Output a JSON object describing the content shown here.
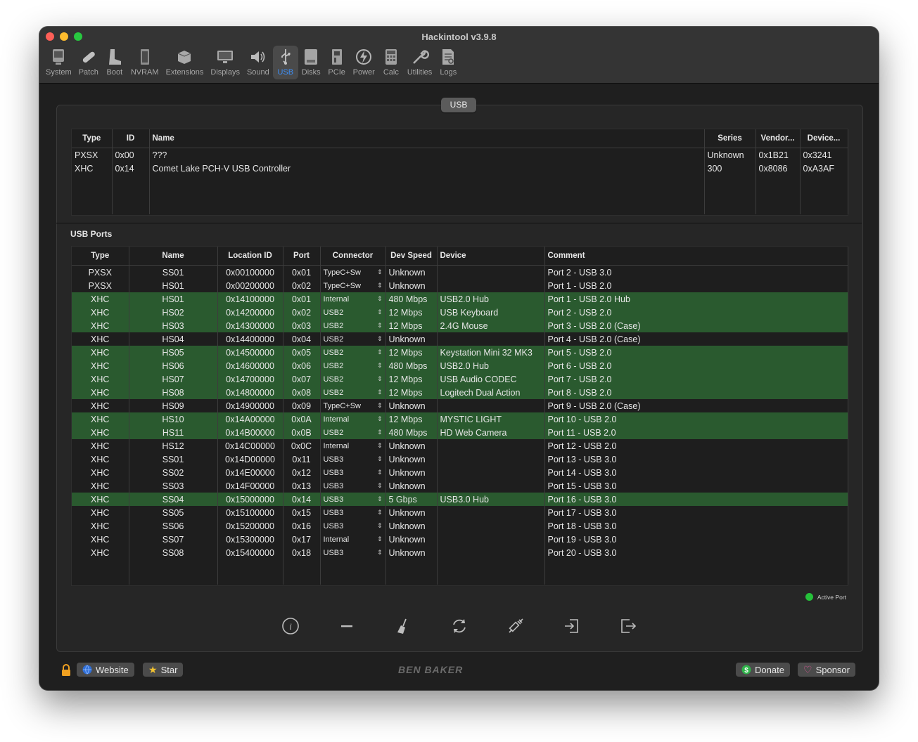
{
  "window": {
    "title": "Hackintool v3.9.8"
  },
  "toolbar": [
    {
      "label": "System",
      "icon": "system-icon"
    },
    {
      "label": "Patch",
      "icon": "patch-icon"
    },
    {
      "label": "Boot",
      "icon": "boot-icon"
    },
    {
      "label": "NVRAM",
      "icon": "nvram-icon"
    },
    {
      "label": "Extensions",
      "icon": "extensions-icon"
    },
    {
      "label": "Displays",
      "icon": "displays-icon"
    },
    {
      "label": "Sound",
      "icon": "sound-icon"
    },
    {
      "label": "USB",
      "icon": "usb-icon",
      "active": true
    },
    {
      "label": "Disks",
      "icon": "disks-icon"
    },
    {
      "label": "PCIe",
      "icon": "pcie-icon"
    },
    {
      "label": "Power",
      "icon": "power-icon"
    },
    {
      "label": "Calc",
      "icon": "calc-icon"
    },
    {
      "label": "Utilities",
      "icon": "utilities-icon"
    },
    {
      "label": "Logs",
      "icon": "logs-icon"
    }
  ],
  "segment": {
    "label": "USB"
  },
  "controllers": {
    "columns": [
      "Type",
      "ID",
      "Name",
      "Series",
      "Vendor...",
      "Device..."
    ],
    "rows": [
      [
        "PXSX",
        "0x00",
        "???",
        "Unknown",
        "0x1B21",
        "0x3241"
      ],
      [
        "XHC",
        "0x14",
        "Comet Lake PCH-V USB Controller",
        "300",
        "0x8086",
        "0xA3AF"
      ]
    ]
  },
  "ports": {
    "section_label": "USB Ports",
    "columns": [
      "Type",
      "Name",
      "Location ID",
      "Port",
      "Connector",
      "Dev Speed",
      "Device",
      "Comment"
    ],
    "rows": [
      {
        "type": "PXSX",
        "name": "SS01",
        "location": "0x00100000",
        "port": "0x01",
        "connector": "TypeC+Sw",
        "speed": "Unknown",
        "device": "",
        "comment": "Port 2 - USB 3.0",
        "active": false
      },
      {
        "type": "PXSX",
        "name": "HS01",
        "location": "0x00200000",
        "port": "0x02",
        "connector": "TypeC+Sw",
        "speed": "Unknown",
        "device": "",
        "comment": "Port 1 - USB 2.0",
        "active": false
      },
      {
        "type": "XHC",
        "name": "HS01",
        "location": "0x14100000",
        "port": "0x01",
        "connector": "Internal",
        "speed": "480 Mbps",
        "device": "USB2.0 Hub",
        "comment": "Port 1 - USB 2.0 Hub",
        "active": true
      },
      {
        "type": "XHC",
        "name": "HS02",
        "location": "0x14200000",
        "port": "0x02",
        "connector": "USB2",
        "speed": "12 Mbps",
        "device": "USB Keyboard",
        "comment": "Port 2 - USB 2.0",
        "active": true
      },
      {
        "type": "XHC",
        "name": "HS03",
        "location": "0x14300000",
        "port": "0x03",
        "connector": "USB2",
        "speed": "12 Mbps",
        "device": "2.4G Mouse",
        "comment": "Port 3 - USB 2.0 (Case)",
        "active": true
      },
      {
        "type": "XHC",
        "name": "HS04",
        "location": "0x14400000",
        "port": "0x04",
        "connector": "USB2",
        "speed": "Unknown",
        "device": "",
        "comment": "Port 4 - USB 2.0 (Case)",
        "active": false
      },
      {
        "type": "XHC",
        "name": "HS05",
        "location": "0x14500000",
        "port": "0x05",
        "connector": "USB2",
        "speed": "12 Mbps",
        "device": "Keystation Mini 32 MK3",
        "comment": "Port 5 - USB 2.0",
        "active": true
      },
      {
        "type": "XHC",
        "name": "HS06",
        "location": "0x14600000",
        "port": "0x06",
        "connector": "USB2",
        "speed": "480 Mbps",
        "device": "USB2.0 Hub",
        "comment": "Port 6 - USB 2.0",
        "active": true
      },
      {
        "type": "XHC",
        "name": "HS07",
        "location": "0x14700000",
        "port": "0x07",
        "connector": "USB2",
        "speed": "12 Mbps",
        "device": "USB Audio CODEC",
        "comment": "Port 7 - USB 2.0",
        "active": true
      },
      {
        "type": "XHC",
        "name": "HS08",
        "location": "0x14800000",
        "port": "0x08",
        "connector": "USB2",
        "speed": "12 Mbps",
        "device": "Logitech Dual Action",
        "comment": "Port 8 - USB 2.0",
        "active": true
      },
      {
        "type": "XHC",
        "name": "HS09",
        "location": "0x14900000",
        "port": "0x09",
        "connector": "TypeC+Sw",
        "speed": "Unknown",
        "device": "",
        "comment": "Port 9 - USB 2.0 (Case)",
        "active": false
      },
      {
        "type": "XHC",
        "name": "HS10",
        "location": "0x14A00000",
        "port": "0x0A",
        "connector": "Internal",
        "speed": "12 Mbps",
        "device": "MYSTIC LIGHT",
        "comment": "Port 10 - USB 2.0",
        "active": true
      },
      {
        "type": "XHC",
        "name": "HS11",
        "location": "0x14B00000",
        "port": "0x0B",
        "connector": "USB2",
        "speed": "480 Mbps",
        "device": "HD Web Camera",
        "comment": "Port 11 - USB 2.0",
        "active": true
      },
      {
        "type": "XHC",
        "name": "HS12",
        "location": "0x14C00000",
        "port": "0x0C",
        "connector": "Internal",
        "speed": "Unknown",
        "device": "",
        "comment": "Port 12 - USB 2.0",
        "active": false
      },
      {
        "type": "XHC",
        "name": "SS01",
        "location": "0x14D00000",
        "port": "0x11",
        "connector": "USB3",
        "speed": "Unknown",
        "device": "",
        "comment": "Port 13 - USB 3.0",
        "active": false
      },
      {
        "type": "XHC",
        "name": "SS02",
        "location": "0x14E00000",
        "port": "0x12",
        "connector": "USB3",
        "speed": "Unknown",
        "device": "",
        "comment": "Port 14 - USB 3.0",
        "active": false
      },
      {
        "type": "XHC",
        "name": "SS03",
        "location": "0x14F00000",
        "port": "0x13",
        "connector": "USB3",
        "speed": "Unknown",
        "device": "",
        "comment": "Port 15 - USB 3.0",
        "active": false
      },
      {
        "type": "XHC",
        "name": "SS04",
        "location": "0x15000000",
        "port": "0x14",
        "connector": "USB3",
        "speed": "5 Gbps",
        "device": "USB3.0 Hub",
        "comment": "Port 16 - USB 3.0",
        "active": true
      },
      {
        "type": "XHC",
        "name": "SS05",
        "location": "0x15100000",
        "port": "0x15",
        "connector": "USB3",
        "speed": "Unknown",
        "device": "",
        "comment": "Port 17 - USB 3.0",
        "active": false
      },
      {
        "type": "XHC",
        "name": "SS06",
        "location": "0x15200000",
        "port": "0x16",
        "connector": "USB3",
        "speed": "Unknown",
        "device": "",
        "comment": "Port 18 - USB 3.0",
        "active": false
      },
      {
        "type": "XHC",
        "name": "SS07",
        "location": "0x15300000",
        "port": "0x17",
        "connector": "Internal",
        "speed": "Unknown",
        "device": "",
        "comment": "Port 19 - USB 3.0",
        "active": false
      },
      {
        "type": "XHC",
        "name": "SS08",
        "location": "0x15400000",
        "port": "0x18",
        "connector": "USB3",
        "speed": "Unknown",
        "device": "",
        "comment": "Port 20 - USB 3.0",
        "active": false
      }
    ]
  },
  "legend": {
    "label": "Active Port",
    "color": "#25c13a"
  },
  "actions": [
    "info-icon",
    "remove-icon",
    "clear-icon",
    "refresh-icon",
    "inject-icon",
    "import-icon",
    "export-icon"
  ],
  "footer": {
    "website": "Website",
    "star": "Star",
    "brand": "BEN BAKER",
    "donate": "Donate",
    "sponsor": "Sponsor"
  },
  "colors": {
    "active_row": "#2a5a2f",
    "accent": "#3e8ff7"
  }
}
